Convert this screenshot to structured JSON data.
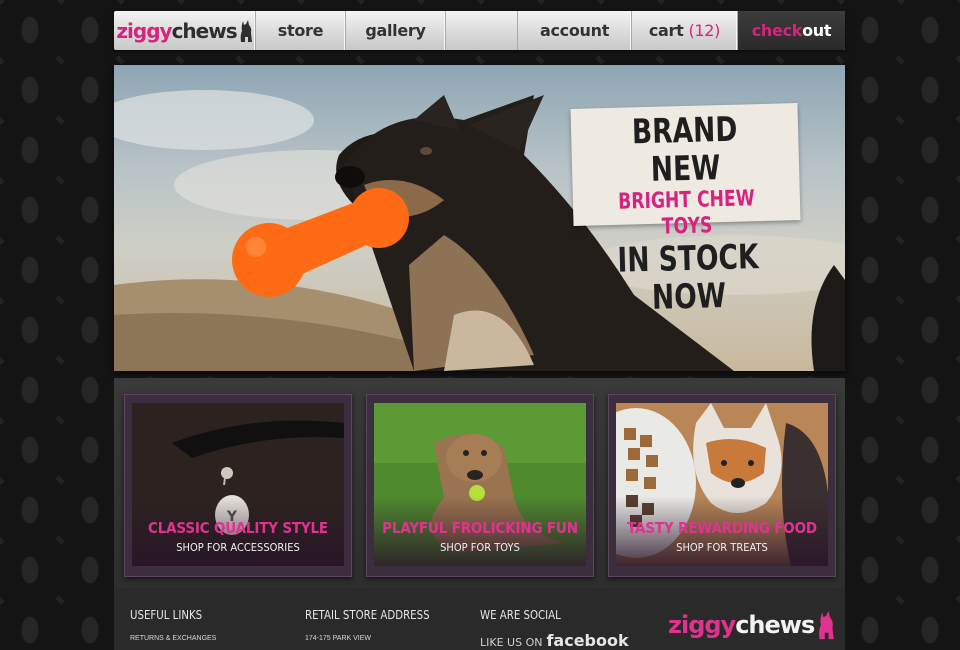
{
  "nav": {
    "logo_part1": "ziggy",
    "logo_part2": "chews",
    "store": "store",
    "gallery": "gallery",
    "account": "account",
    "cart_label": "cart",
    "cart_count": "(12)",
    "checkout_part1": "check",
    "checkout_part2": "out"
  },
  "hero": {
    "line1": "BRAND NEW",
    "line2": "BRIGHT CHEW TOYS",
    "line3": "IN STOCK NOW"
  },
  "tiles": [
    {
      "title": "CLASSIC QUALITY STYLE",
      "subtitle": "SHOP FOR ACCESSORIES"
    },
    {
      "title": "PLAYFUL FROLICKING FUN",
      "subtitle": "SHOP FOR TOYS"
    },
    {
      "title": "TASTY REWARDING FOOD",
      "subtitle": "SHOP FOR TREATS"
    }
  ],
  "footer": {
    "useful_links": "USEFUL LINKS",
    "returns": "RETURNS & EXCHANGES",
    "store_address": "RETAIL STORE ADDRESS",
    "address_line": "174-175 PARK VIEW",
    "social": "WE ARE SOCIAL",
    "like_us": "LIKE US ON",
    "facebook": "facebook",
    "logo_part1": "ziggy",
    "logo_part2": "chews"
  },
  "colors": {
    "accent": "#d6237f",
    "nav_bg": "#d8d8d8",
    "checkout_bg": "#2a2a2a"
  }
}
